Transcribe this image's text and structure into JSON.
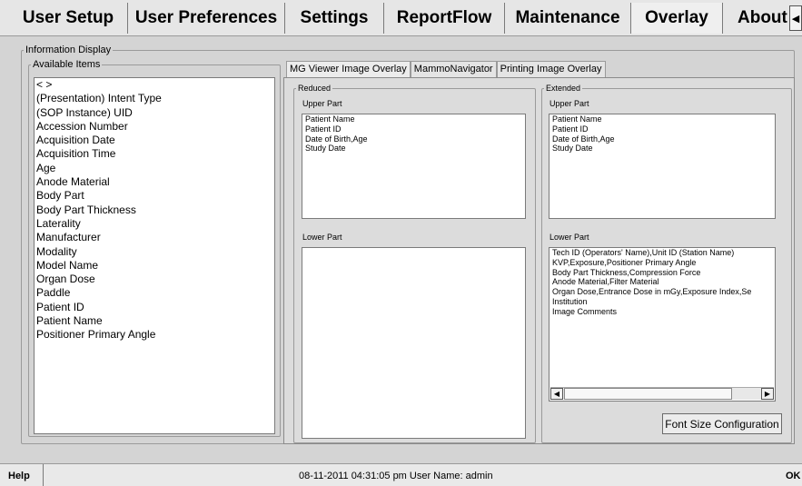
{
  "main_tabs": [
    {
      "label": "User Setup",
      "active": false
    },
    {
      "label": "User Preferences",
      "active": false
    },
    {
      "label": "Settings",
      "active": false
    },
    {
      "label": "ReportFlow",
      "active": false
    },
    {
      "label": "Maintenance",
      "active": false
    },
    {
      "label": "Overlay",
      "active": true
    },
    {
      "label": "About",
      "active": false
    }
  ],
  "tab_scroll_glyph": "◀",
  "info_display": {
    "legend": "Information Display",
    "available": {
      "legend": "Available Items",
      "items": [
        "< >",
        "(Presentation) Intent Type",
        "(SOP Instance) UID",
        "Accession Number",
        "Acquisition Date",
        "Acquisition Time",
        "Age",
        "Anode Material",
        "Body Part",
        "Body Part Thickness",
        "Laterality",
        "Manufacturer",
        "Modality",
        "Model Name",
        "Organ Dose",
        "Paddle",
        "Patient ID",
        "Patient Name",
        "Positioner Primary Angle"
      ]
    }
  },
  "sub_tabs": [
    {
      "label": "MG Viewer Image Overlay",
      "active": true
    },
    {
      "label": "MammoNavigator",
      "active": false
    },
    {
      "label": "Printing Image Overlay",
      "active": false
    }
  ],
  "reduced": {
    "legend": "Reduced",
    "upper_label": "Upper Part",
    "upper_items": [
      "Patient Name",
      "Patient ID",
      "Date of Birth,Age",
      "Study Date"
    ],
    "lower_label": "Lower Part",
    "lower_items": []
  },
  "extended": {
    "legend": "Extended",
    "upper_label": "Upper Part",
    "upper_items": [
      "Patient Name",
      "Patient ID",
      "Date of Birth,Age",
      "Study Date"
    ],
    "lower_label": "Lower Part",
    "lower_items": [
      "Tech ID (Operators' Name),Unit ID (Station Name)",
      "KVP,Exposure,Positioner Primary Angle",
      "Body Part Thickness,Compression Force",
      "Anode Material,Filter Material",
      "Organ Dose,Entrance Dose in mGy,Exposure Index,Se",
      "Institution",
      "Image Comments"
    ]
  },
  "scroll_left_glyph": "◀",
  "scroll_right_glyph": "▶",
  "font_size_button": "Font Size Configuration",
  "status": {
    "help": "Help",
    "text": "08-11-2011  04:31:05 pm  User Name:  admin",
    "ok": "OK"
  }
}
